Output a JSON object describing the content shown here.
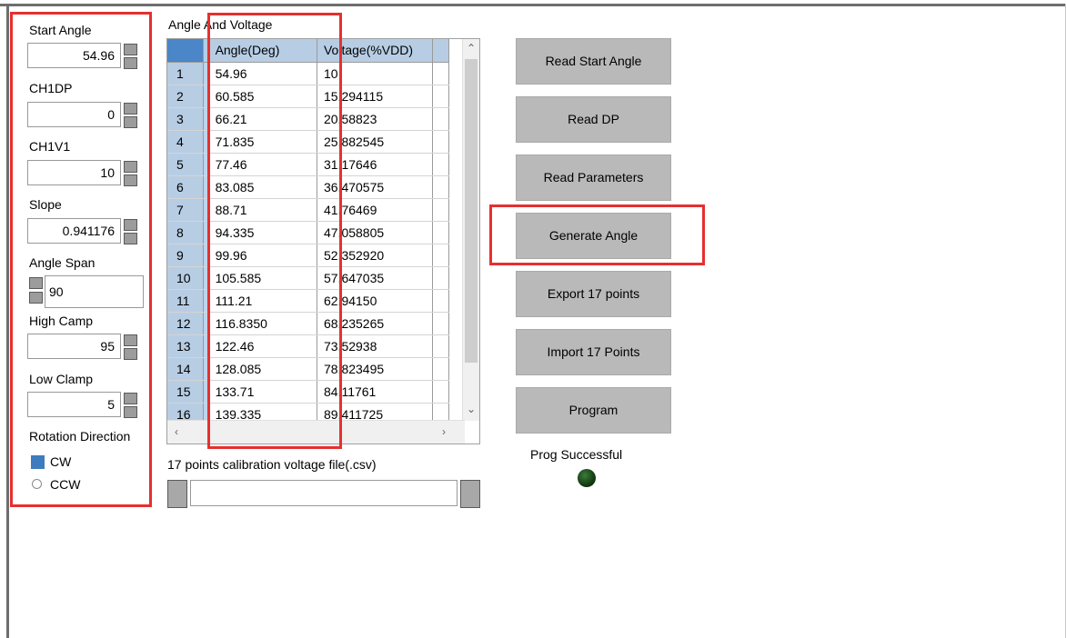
{
  "params": {
    "start_angle": {
      "label": "Start Angle",
      "value": "54.96"
    },
    "ch1dp": {
      "label": "CH1DP",
      "value": "0"
    },
    "ch1v1": {
      "label": "CH1V1",
      "value": "10"
    },
    "slope": {
      "label": "Slope",
      "value": "0.941176"
    },
    "angle_span": {
      "label": "Angle Span",
      "value": "90"
    },
    "high_camp": {
      "label": "High Camp",
      "value": "95"
    },
    "low_clamp": {
      "label": "Low Clamp",
      "value": "5"
    },
    "rotation": {
      "label": "Rotation Direction",
      "cw": "CW",
      "ccw": "CCW",
      "selected": "CW"
    }
  },
  "table": {
    "title": "Angle And Voltage",
    "columns": [
      "Angle(Deg)",
      "Voltage(%VDD)"
    ],
    "rows": [
      [
        "1",
        "54.96",
        "10"
      ],
      [
        "2",
        "60.585",
        "15.294115"
      ],
      [
        "3",
        "66.21",
        "20.58823"
      ],
      [
        "4",
        "71.835",
        "25.882545"
      ],
      [
        "5",
        "77.46",
        "31.17646"
      ],
      [
        "6",
        "83.085",
        "36.470575"
      ],
      [
        "7",
        "88.71",
        "41.76469"
      ],
      [
        "8",
        "94.335",
        "47.058805"
      ],
      [
        "9",
        "99.96",
        "52.352920"
      ],
      [
        "10",
        "105.585",
        "57.647035"
      ],
      [
        "11",
        "111.21",
        "62.94150"
      ],
      [
        "12",
        "116.8350",
        "68.235265"
      ],
      [
        "13",
        "122.46",
        "73.52938"
      ],
      [
        "14",
        "128.085",
        "78.823495"
      ],
      [
        "15",
        "133.71",
        "84.11761"
      ],
      [
        "16",
        "139.335",
        "89.411725"
      ]
    ]
  },
  "file": {
    "label": "17 points calibration voltage file(.csv)",
    "value": ""
  },
  "buttons": {
    "read_start_angle": "Read Start  Angle",
    "read_dp": "Read DP",
    "read_parameters": "Read Parameters",
    "generate_angle": "Generate Angle",
    "export": "Export 17 points",
    "import": "Import  17 Points",
    "program": "Program"
  },
  "status": {
    "text": "Prog Successful",
    "led_color": "#1f5a1f"
  },
  "colors": {
    "highlight": "#e6302e",
    "header": "#b7cde4",
    "button": "#b9b9b9"
  }
}
